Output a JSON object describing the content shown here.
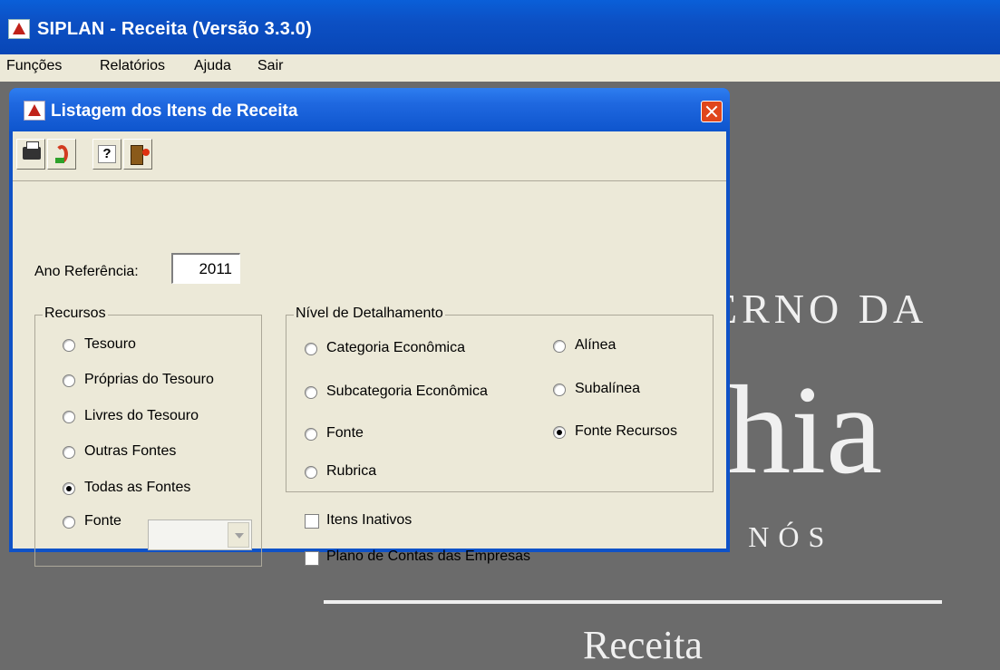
{
  "app": {
    "title": "SIPLAN - Receita (Versão 3.3.0)"
  },
  "menu": [
    "Funções",
    "Relatórios",
    "Ajuda",
    "Sair"
  ],
  "background": {
    "line1": "ERNO DA",
    "line2": "ahia",
    "line3": "TERRA DE TODOS NÓS",
    "line4": "Receita"
  },
  "dialog": {
    "title": "Listagem dos Itens de Receita",
    "toolbar": [
      "printer-icon",
      "return-icon",
      "help-icon",
      "exit-icon"
    ],
    "help_label": "?",
    "year_label": "Ano Referência:",
    "year_value": "2011",
    "recursos": {
      "legend": "Recursos",
      "options": [
        "Tesouro",
        "Próprias do Tesouro",
        "Livres do Tesouro",
        "Outras Fontes",
        "Todas as Fontes",
        "Fonte"
      ],
      "selected": "Todas as Fontes",
      "fonte_combo_value": ""
    },
    "nivel": {
      "legend": "Nível de Detalhamento",
      "options_left": [
        "Categoria Econômica",
        "Subcategoria Econômica",
        "Fonte",
        "Rubrica"
      ],
      "options_right": [
        "Alínea",
        "Subalínea",
        "Fonte Recursos"
      ],
      "selected": "Fonte Recursos"
    },
    "checkboxes": [
      {
        "label": "Itens Inativos",
        "checked": false
      },
      {
        "label": "Plano de Contas das Empresas",
        "checked": false
      }
    ]
  }
}
